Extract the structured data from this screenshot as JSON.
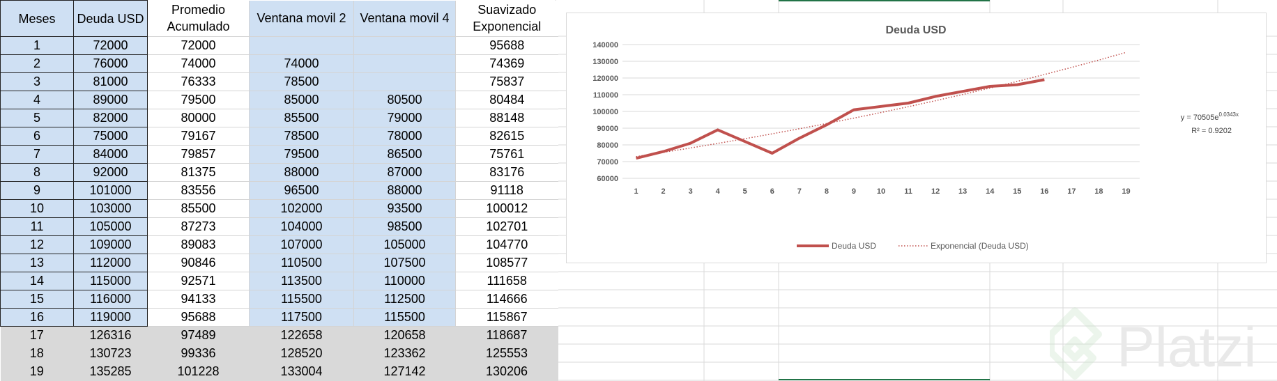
{
  "table": {
    "headers": [
      "Meses",
      "Deuda USD",
      "Promedio Acumulado",
      "Ventana movil 2",
      "Ventana movil 4",
      "Suavizado Exponencial"
    ],
    "rows": [
      [
        "1",
        "72000",
        "72000",
        "",
        "",
        "95688"
      ],
      [
        "2",
        "76000",
        "74000",
        "74000",
        "",
        "74369"
      ],
      [
        "3",
        "81000",
        "76333",
        "78500",
        "",
        "75837"
      ],
      [
        "4",
        "89000",
        "79500",
        "85000",
        "80500",
        "80484"
      ],
      [
        "5",
        "82000",
        "80000",
        "85500",
        "79000",
        "88148"
      ],
      [
        "6",
        "75000",
        "79167",
        "78500",
        "78000",
        "82615"
      ],
      [
        "7",
        "84000",
        "79857",
        "79500",
        "86500",
        "75761"
      ],
      [
        "8",
        "92000",
        "81375",
        "88000",
        "87000",
        "83176"
      ],
      [
        "9",
        "101000",
        "83556",
        "96500",
        "88000",
        "91118"
      ],
      [
        "10",
        "103000",
        "85500",
        "102000",
        "93500",
        "100012"
      ],
      [
        "11",
        "105000",
        "87273",
        "104000",
        "98500",
        "102701"
      ],
      [
        "12",
        "109000",
        "89083",
        "107000",
        "105000",
        "104770"
      ],
      [
        "13",
        "112000",
        "90846",
        "110500",
        "107500",
        "108577"
      ],
      [
        "14",
        "115000",
        "92571",
        "113500",
        "110000",
        "111658"
      ],
      [
        "15",
        "116000",
        "94133",
        "115500",
        "112500",
        "114666"
      ],
      [
        "16",
        "119000",
        "95688",
        "117500",
        "115500",
        "115867"
      ],
      [
        "17",
        "126316",
        "97489",
        "122658",
        "120658",
        "118687"
      ],
      [
        "18",
        "130723",
        "99336",
        "128520",
        "123362",
        "125553"
      ],
      [
        "19",
        "135285",
        "101228",
        "133004",
        "127142",
        "130206"
      ]
    ]
  },
  "chart_data": {
    "type": "line",
    "title": "Deuda USD",
    "categories": [
      "1",
      "2",
      "3",
      "4",
      "5",
      "6",
      "7",
      "8",
      "9",
      "10",
      "11",
      "12",
      "13",
      "14",
      "15",
      "16",
      "17",
      "18",
      "19"
    ],
    "series": [
      {
        "name": "Deuda USD",
        "color": "#c0504d",
        "values": [
          72000,
          76000,
          81000,
          89000,
          82000,
          75000,
          84000,
          92000,
          101000,
          103000,
          105000,
          109000,
          112000,
          115000,
          116000,
          119000
        ]
      },
      {
        "name": "Exponencial (Deuda USD)",
        "color": "#c0504d",
        "style": "dotted",
        "values": [
          72965,
          75514,
          78149,
          80877,
          83700,
          86622,
          89646,
          92775,
          96013,
          99365,
          102834,
          106423,
          110138,
          113983,
          117962,
          122080,
          126341,
          130751,
          135315
        ]
      }
    ],
    "ylim": [
      60000,
      140000
    ],
    "yticks": [
      "60000",
      "70000",
      "80000",
      "90000",
      "100000",
      "110000",
      "120000",
      "130000",
      "140000"
    ],
    "grid": true,
    "legend": "bottom",
    "equation": {
      "base": "y = 70505e",
      "exponent": "0.0343x",
      "r2": "R² = 0.9202"
    }
  },
  "watermark": {
    "text": "Platzi"
  }
}
